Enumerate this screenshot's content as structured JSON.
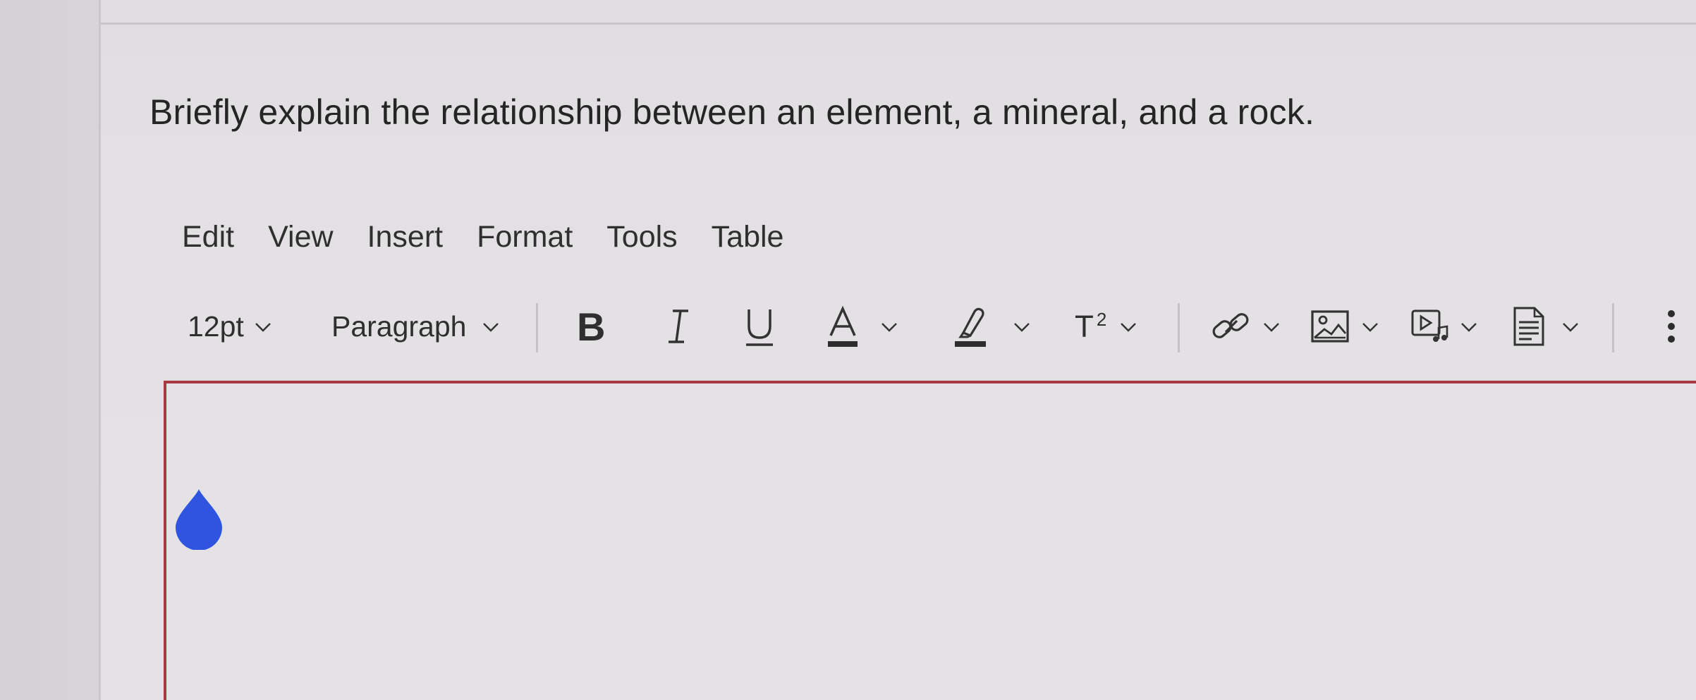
{
  "question": {
    "text": "Briefly explain the relationship between an element, a mineral, and a rock."
  },
  "menubar": {
    "items": [
      "Edit",
      "View",
      "Insert",
      "Format",
      "Tools",
      "Table"
    ]
  },
  "toolbar": {
    "font_size": "12pt",
    "block_format": "Paragraph",
    "bold_label": "B",
    "italic_label": "I",
    "underline_label": "U",
    "text_color_label": "A",
    "superscript_label": "T",
    "superscript_exp": "2",
    "icons": [
      "bold-icon",
      "italic-icon",
      "underline-icon",
      "text-color-icon",
      "highlight-icon",
      "superscript-icon",
      "link-icon",
      "image-icon",
      "media-icon",
      "document-icon",
      "more-options-icon"
    ]
  },
  "colors": {
    "editor_border": "#a63a43",
    "cursor_handle": "#2f55e0"
  }
}
